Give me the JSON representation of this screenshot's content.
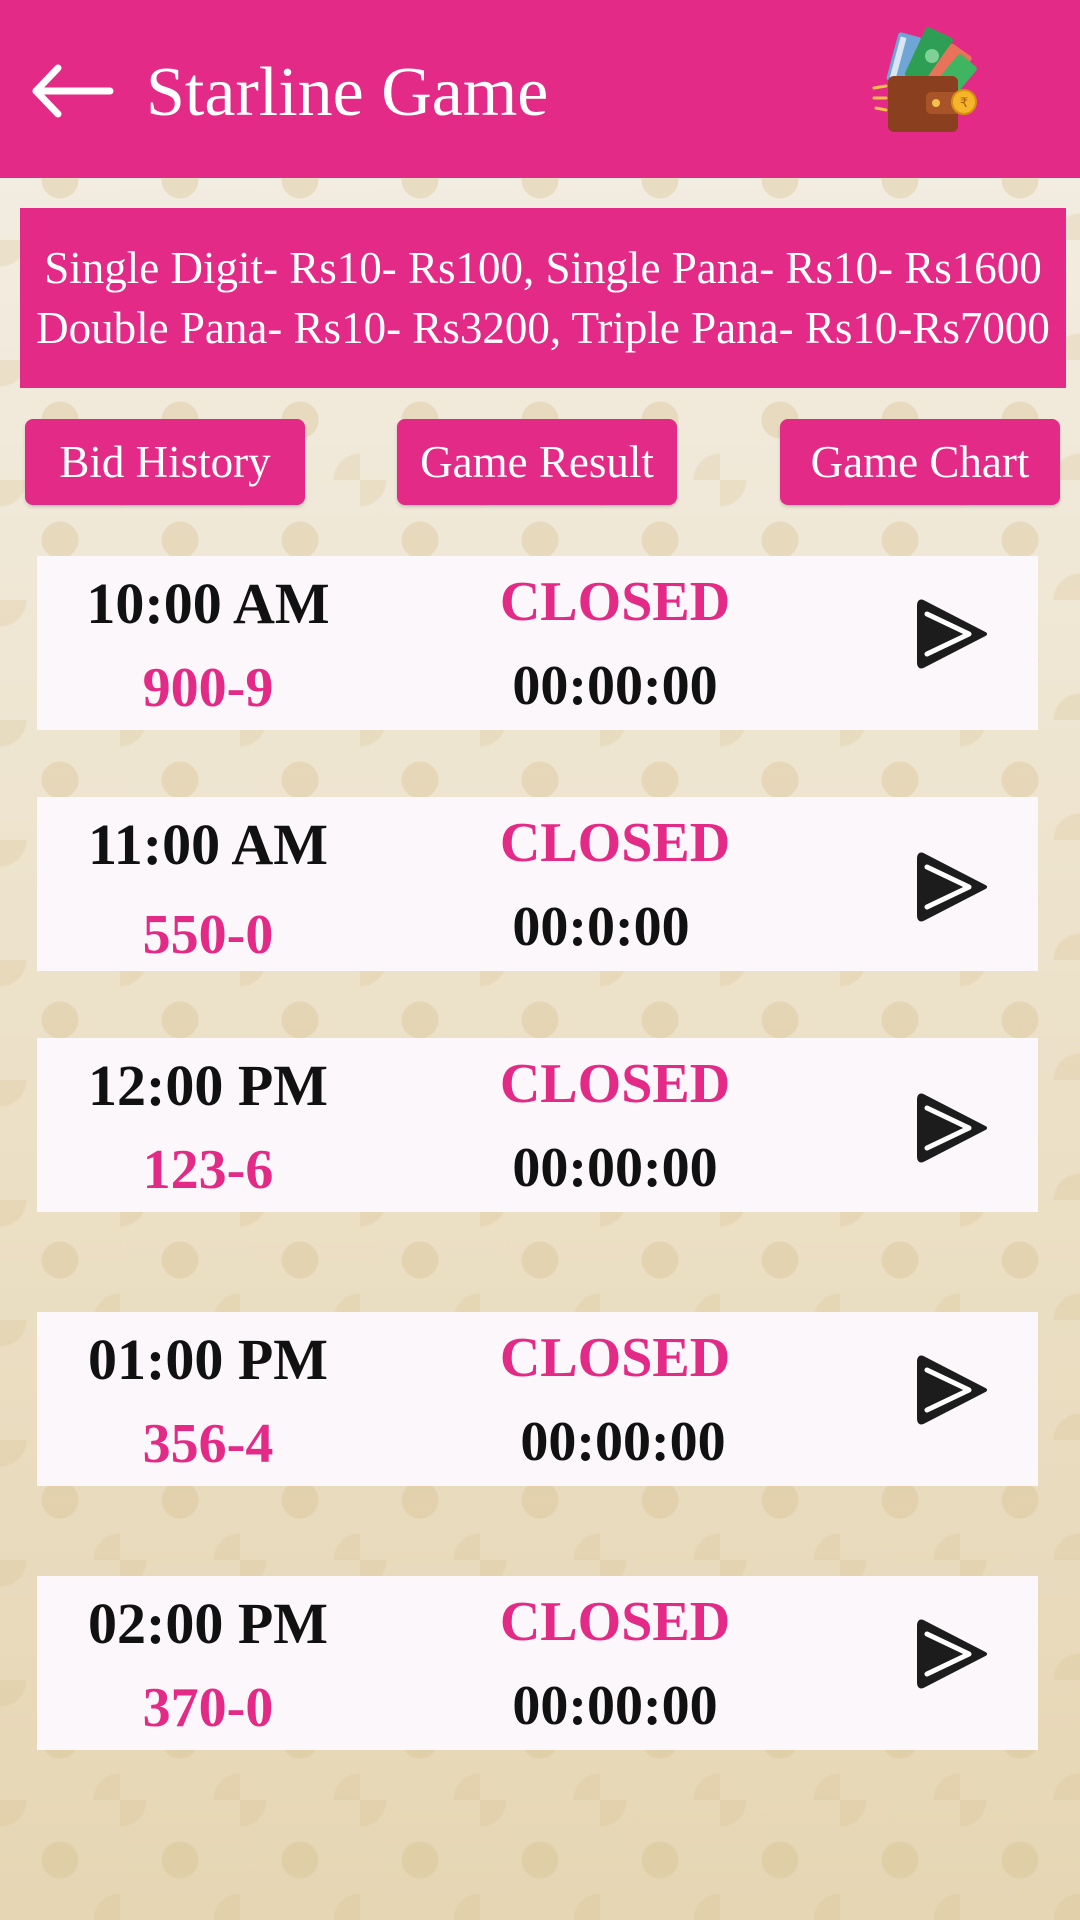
{
  "header": {
    "title": "Starline Game",
    "back_icon": "arrow-left-icon",
    "wallet_icon": "wallet-icon",
    "brand_color": "#e22a86"
  },
  "rates": {
    "line1": "Single Digit- Rs10- Rs100, Single Pana- Rs10- Rs1600",
    "line2": "Double Pana- Rs10- Rs3200, Triple Pana- Rs10-Rs7000"
  },
  "actions": {
    "bid_history": "Bid History",
    "game_result": "Game Result",
    "game_chart": "Game Chart"
  },
  "games": [
    {
      "time": "10:00 AM",
      "result": "900-9",
      "status": "CLOSED",
      "timer": "00:00:00"
    },
    {
      "time": "11:00 AM",
      "result": "550-0",
      "status": "CLOSED",
      "timer": "00:0:00"
    },
    {
      "time": "12:00 PM",
      "result": "123-6",
      "status": "CLOSED",
      "timer": "00:00:00"
    },
    {
      "time": "01:00 PM",
      "result": "356-4",
      "status": "CLOSED",
      "timer": "00:00:00"
    },
    {
      "time": "02:00 PM",
      "result": "370-0",
      "status": "CLOSED",
      "timer": "00:00:00"
    }
  ]
}
